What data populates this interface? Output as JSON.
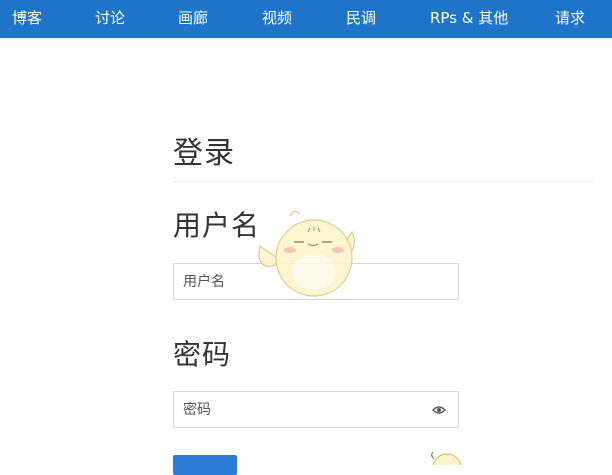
{
  "nav": {
    "items": [
      {
        "label": "博客"
      },
      {
        "label": "讨论"
      },
      {
        "label": "画廊"
      },
      {
        "label": "视频"
      },
      {
        "label": "民调"
      },
      {
        "label": "RPs & 其他"
      },
      {
        "label": "请求"
      }
    ]
  },
  "login": {
    "title": "登录",
    "username": {
      "label": "用户名",
      "placeholder": "用户名"
    },
    "password": {
      "label": "密码",
      "placeholder": "密码",
      "toggle_icon": "eye-icon"
    }
  },
  "decor": {
    "mascot_icon": "chick-mascot-icon"
  },
  "colors": {
    "nav_bg": "#1e74c9",
    "button_bg": "#2c7bd6"
  }
}
